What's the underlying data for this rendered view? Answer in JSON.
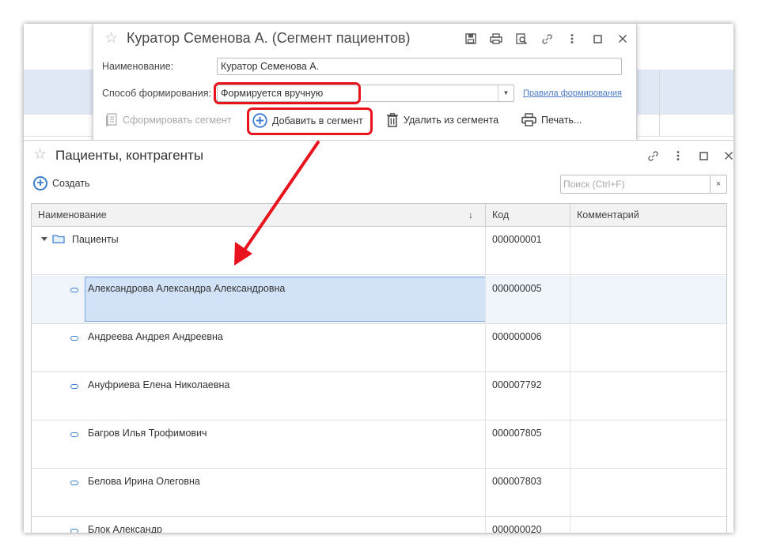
{
  "form_window": {
    "title": "Куратор Семенова А. (Сегмент пациентов)",
    "name_label": "Наименование:",
    "name_value": "Куратор Семенова А.",
    "method_label": "Способ формирования:",
    "method_value": "Формируется вручную",
    "rules_link": "Правила формирования",
    "commands": {
      "generate": "Сформировать сегмент",
      "add": "Добавить в сегмент",
      "remove": "Удалить из сегмента",
      "print": "Печать..."
    },
    "icons": [
      "save-icon",
      "print-icon",
      "preview-icon",
      "link-icon",
      "more-icon",
      "maximize-icon",
      "close-icon"
    ]
  },
  "list_window": {
    "title": "Пациенты, контрагенты",
    "create_label": "Создать",
    "search_placeholder": "Поиск (Ctrl+F)",
    "search_clear": "×",
    "columns": [
      "Наименование",
      "Код",
      "Комментарий"
    ],
    "sort_indicator": "↓",
    "rows": [
      {
        "name": "Пациенты",
        "code": "000000001",
        "comment": "",
        "type": "group"
      },
      {
        "name": "Александрова Александра Александровна",
        "code": "000000005",
        "comment": "",
        "type": "item",
        "selected": true
      },
      {
        "name": "Андреева Андрея Андреевна",
        "code": "000000006",
        "comment": "",
        "type": "item"
      },
      {
        "name": "Ануфриева Елена Николаевна",
        "code": "000007792",
        "comment": "",
        "type": "item"
      },
      {
        "name": "Багров Илья Трофимович",
        "code": "000007805",
        "comment": "",
        "type": "item"
      },
      {
        "name": "Белова Ирина Олеговна",
        "code": "000007803",
        "comment": "",
        "type": "item"
      },
      {
        "name": "Блок Александр",
        "code": "000000020",
        "comment": "",
        "type": "item"
      }
    ]
  },
  "colors": {
    "accent": "#3b7ed0",
    "highlight": "#e8131d",
    "selection": "#d3e3f7",
    "link": "#4a7bc4"
  }
}
